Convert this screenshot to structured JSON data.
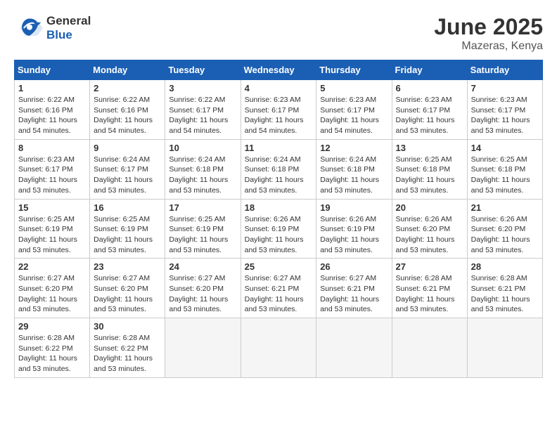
{
  "logo": {
    "general": "General",
    "blue": "Blue"
  },
  "title": "June 2025",
  "location": "Mazeras, Kenya",
  "days_of_week": [
    "Sunday",
    "Monday",
    "Tuesday",
    "Wednesday",
    "Thursday",
    "Friday",
    "Saturday"
  ],
  "weeks": [
    [
      {
        "day": "1",
        "sunrise": "6:22 AM",
        "sunset": "6:16 PM",
        "daylight": "11 hours and 54 minutes."
      },
      {
        "day": "2",
        "sunrise": "6:22 AM",
        "sunset": "6:16 PM",
        "daylight": "11 hours and 54 minutes."
      },
      {
        "day": "3",
        "sunrise": "6:22 AM",
        "sunset": "6:17 PM",
        "daylight": "11 hours and 54 minutes."
      },
      {
        "day": "4",
        "sunrise": "6:23 AM",
        "sunset": "6:17 PM",
        "daylight": "11 hours and 54 minutes."
      },
      {
        "day": "5",
        "sunrise": "6:23 AM",
        "sunset": "6:17 PM",
        "daylight": "11 hours and 54 minutes."
      },
      {
        "day": "6",
        "sunrise": "6:23 AM",
        "sunset": "6:17 PM",
        "daylight": "11 hours and 53 minutes."
      },
      {
        "day": "7",
        "sunrise": "6:23 AM",
        "sunset": "6:17 PM",
        "daylight": "11 hours and 53 minutes."
      }
    ],
    [
      {
        "day": "8",
        "sunrise": "6:23 AM",
        "sunset": "6:17 PM",
        "daylight": "11 hours and 53 minutes."
      },
      {
        "day": "9",
        "sunrise": "6:24 AM",
        "sunset": "6:17 PM",
        "daylight": "11 hours and 53 minutes."
      },
      {
        "day": "10",
        "sunrise": "6:24 AM",
        "sunset": "6:18 PM",
        "daylight": "11 hours and 53 minutes."
      },
      {
        "day": "11",
        "sunrise": "6:24 AM",
        "sunset": "6:18 PM",
        "daylight": "11 hours and 53 minutes."
      },
      {
        "day": "12",
        "sunrise": "6:24 AM",
        "sunset": "6:18 PM",
        "daylight": "11 hours and 53 minutes."
      },
      {
        "day": "13",
        "sunrise": "6:25 AM",
        "sunset": "6:18 PM",
        "daylight": "11 hours and 53 minutes."
      },
      {
        "day": "14",
        "sunrise": "6:25 AM",
        "sunset": "6:18 PM",
        "daylight": "11 hours and 53 minutes."
      }
    ],
    [
      {
        "day": "15",
        "sunrise": "6:25 AM",
        "sunset": "6:19 PM",
        "daylight": "11 hours and 53 minutes."
      },
      {
        "day": "16",
        "sunrise": "6:25 AM",
        "sunset": "6:19 PM",
        "daylight": "11 hours and 53 minutes."
      },
      {
        "day": "17",
        "sunrise": "6:25 AM",
        "sunset": "6:19 PM",
        "daylight": "11 hours and 53 minutes."
      },
      {
        "day": "18",
        "sunrise": "6:26 AM",
        "sunset": "6:19 PM",
        "daylight": "11 hours and 53 minutes."
      },
      {
        "day": "19",
        "sunrise": "6:26 AM",
        "sunset": "6:19 PM",
        "daylight": "11 hours and 53 minutes."
      },
      {
        "day": "20",
        "sunrise": "6:26 AM",
        "sunset": "6:20 PM",
        "daylight": "11 hours and 53 minutes."
      },
      {
        "day": "21",
        "sunrise": "6:26 AM",
        "sunset": "6:20 PM",
        "daylight": "11 hours and 53 minutes."
      }
    ],
    [
      {
        "day": "22",
        "sunrise": "6:27 AM",
        "sunset": "6:20 PM",
        "daylight": "11 hours and 53 minutes."
      },
      {
        "day": "23",
        "sunrise": "6:27 AM",
        "sunset": "6:20 PM",
        "daylight": "11 hours and 53 minutes."
      },
      {
        "day": "24",
        "sunrise": "6:27 AM",
        "sunset": "6:20 PM",
        "daylight": "11 hours and 53 minutes."
      },
      {
        "day": "25",
        "sunrise": "6:27 AM",
        "sunset": "6:21 PM",
        "daylight": "11 hours and 53 minutes."
      },
      {
        "day": "26",
        "sunrise": "6:27 AM",
        "sunset": "6:21 PM",
        "daylight": "11 hours and 53 minutes."
      },
      {
        "day": "27",
        "sunrise": "6:28 AM",
        "sunset": "6:21 PM",
        "daylight": "11 hours and 53 minutes."
      },
      {
        "day": "28",
        "sunrise": "6:28 AM",
        "sunset": "6:21 PM",
        "daylight": "11 hours and 53 minutes."
      }
    ],
    [
      {
        "day": "29",
        "sunrise": "6:28 AM",
        "sunset": "6:22 PM",
        "daylight": "11 hours and 53 minutes."
      },
      {
        "day": "30",
        "sunrise": "6:28 AM",
        "sunset": "6:22 PM",
        "daylight": "11 hours and 53 minutes."
      },
      null,
      null,
      null,
      null,
      null
    ]
  ],
  "labels": {
    "sunrise": "Sunrise:",
    "sunset": "Sunset:",
    "daylight": "Daylight:"
  }
}
